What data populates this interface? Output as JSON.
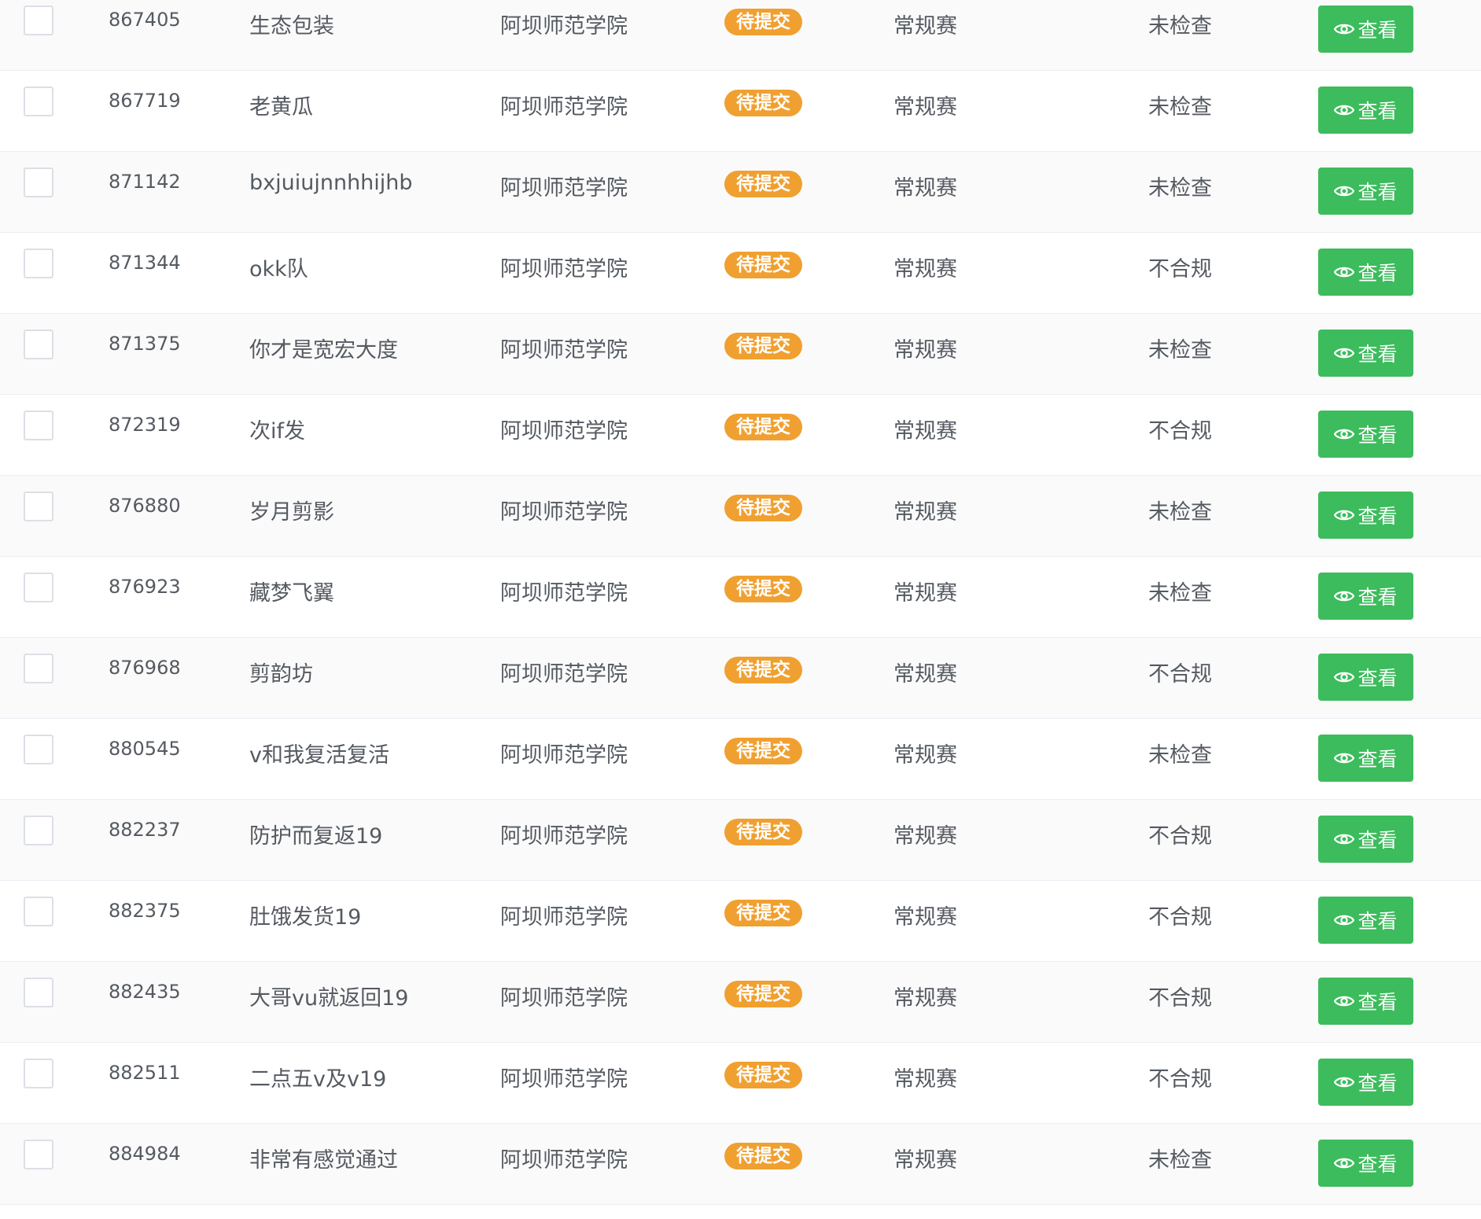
{
  "table": {
    "rows": [
      {
        "id": "867405",
        "name": "生态包装",
        "school": "阿坝师范学院",
        "status": "待提交",
        "type": "常规赛",
        "check": "未检查",
        "action": "查看"
      },
      {
        "id": "867719",
        "name": "老黄瓜",
        "school": "阿坝师范学院",
        "status": "待提交",
        "type": "常规赛",
        "check": "未检查",
        "action": "查看"
      },
      {
        "id": "871142",
        "name": "bxjuiujnnhhijhb",
        "school": "阿坝师范学院",
        "status": "待提交",
        "type": "常规赛",
        "check": "未检查",
        "action": "查看"
      },
      {
        "id": "871344",
        "name": "okk队",
        "school": "阿坝师范学院",
        "status": "待提交",
        "type": "常规赛",
        "check": "不合规",
        "action": "查看"
      },
      {
        "id": "871375",
        "name": "你才是宽宏大度",
        "school": "阿坝师范学院",
        "status": "待提交",
        "type": "常规赛",
        "check": "未检查",
        "action": "查看"
      },
      {
        "id": "872319",
        "name": "次if发",
        "school": "阿坝师范学院",
        "status": "待提交",
        "type": "常规赛",
        "check": "不合规",
        "action": "查看"
      },
      {
        "id": "876880",
        "name": "岁月剪影",
        "school": "阿坝师范学院",
        "status": "待提交",
        "type": "常规赛",
        "check": "未检查",
        "action": "查看"
      },
      {
        "id": "876923",
        "name": "藏梦飞翼",
        "school": "阿坝师范学院",
        "status": "待提交",
        "type": "常规赛",
        "check": "未检查",
        "action": "查看"
      },
      {
        "id": "876968",
        "name": "剪韵坊",
        "school": "阿坝师范学院",
        "status": "待提交",
        "type": "常规赛",
        "check": "不合规",
        "action": "查看"
      },
      {
        "id": "880545",
        "name": "v和我复活复活",
        "school": "阿坝师范学院",
        "status": "待提交",
        "type": "常规赛",
        "check": "未检查",
        "action": "查看"
      },
      {
        "id": "882237",
        "name": "防护而复返19",
        "school": "阿坝师范学院",
        "status": "待提交",
        "type": "常规赛",
        "check": "不合规",
        "action": "查看"
      },
      {
        "id": "882375",
        "name": "肚饿发货19",
        "school": "阿坝师范学院",
        "status": "待提交",
        "type": "常规赛",
        "check": "不合规",
        "action": "查看"
      },
      {
        "id": "882435",
        "name": "大哥vu就返回19",
        "school": "阿坝师范学院",
        "status": "待提交",
        "type": "常规赛",
        "check": "不合规",
        "action": "查看"
      },
      {
        "id": "882511",
        "name": "二点五v及v19",
        "school": "阿坝师范学院",
        "status": "待提交",
        "type": "常规赛",
        "check": "不合规",
        "action": "查看"
      },
      {
        "id": "884984",
        "name": "非常有感觉通过",
        "school": "阿坝师范学院",
        "status": "待提交",
        "type": "常规赛",
        "check": "未检查",
        "action": "查看"
      }
    ]
  },
  "colors": {
    "status_badge": "#f0a030",
    "view_button": "#3cbc5c",
    "row_alt": "#fafafa",
    "border": "#ebeef5"
  },
  "icons": {
    "view_button_icon": "eye-icon"
  }
}
